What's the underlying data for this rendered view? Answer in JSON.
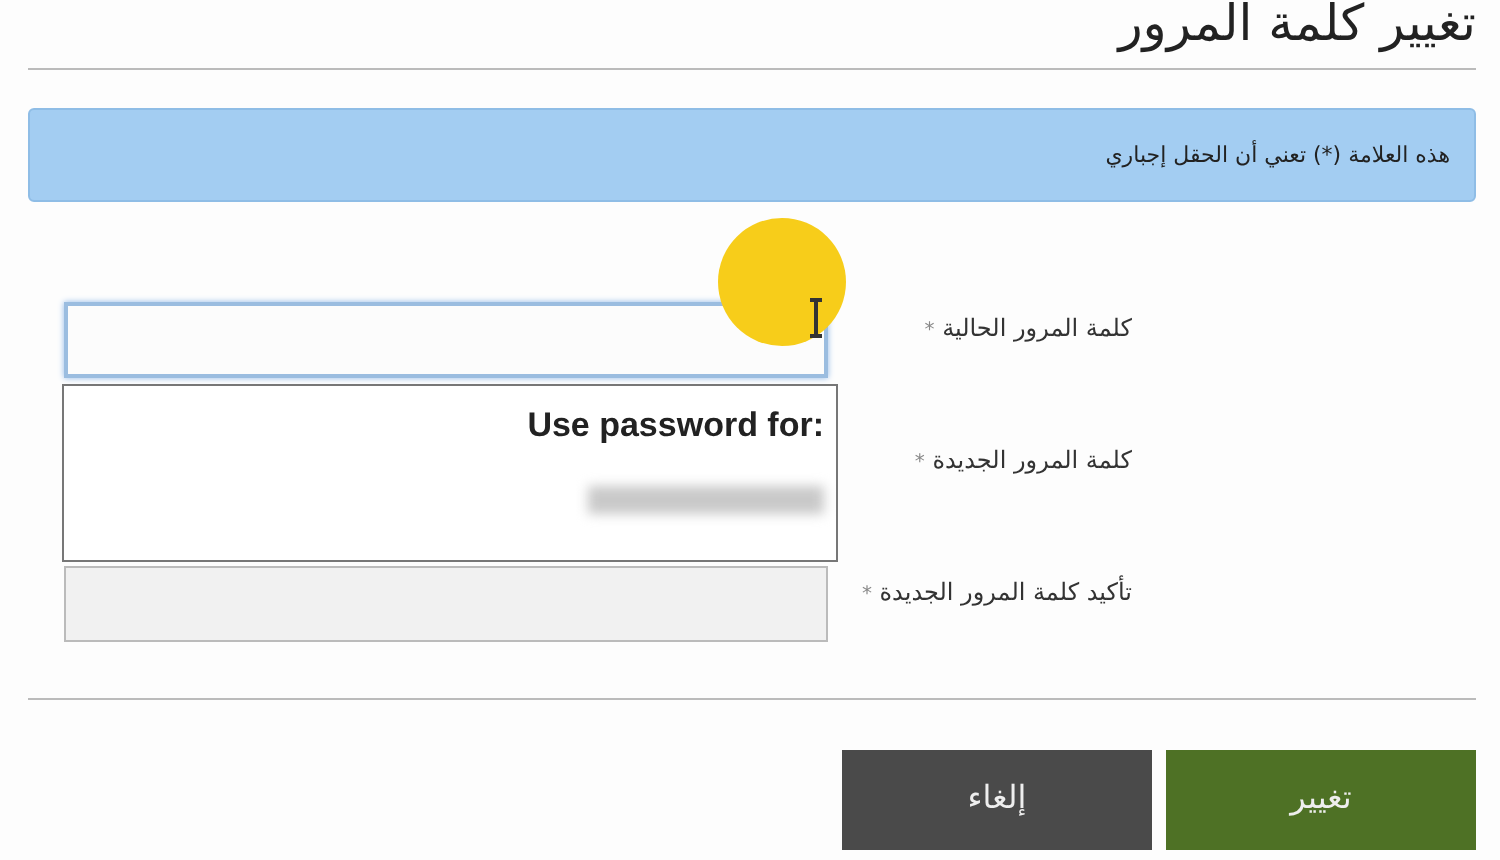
{
  "title": "تغيير كلمة المرور",
  "notice": "هذه العلامة (*) تعني أن الحقل إجباري",
  "fields": [
    {
      "label": "كلمة المرور الحالية",
      "marker": "*",
      "input": {
        "focused": true
      }
    },
    {
      "label": "كلمة المرور الجديدة",
      "marker": "*"
    },
    {
      "label": "تأكيد كلمة المرور الجديدة",
      "marker": "*",
      "input": {
        "focused": false
      }
    }
  ],
  "autofill": {
    "heading": "Use password for:"
  },
  "buttons": [
    {
      "label": "تغيير",
      "kind": "primary"
    },
    {
      "label": "إلغاء",
      "kind": "secondary"
    }
  ]
}
